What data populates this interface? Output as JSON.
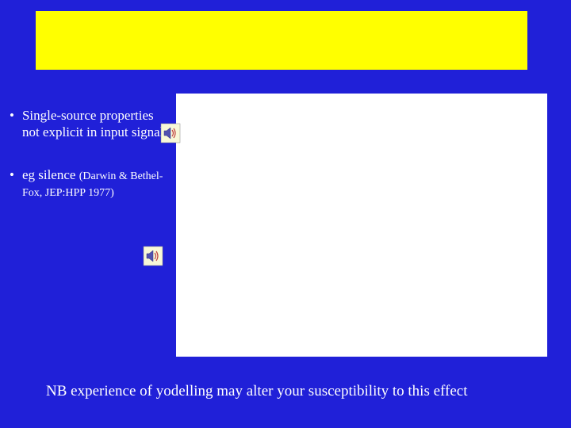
{
  "title": "",
  "bullets": [
    {
      "text": "Single-source properties not explicit in input signal",
      "citation": ""
    },
    {
      "text": "eg  silence  ",
      "citation": "(Darwin & Bethel-Fox, JEP:HPP 1977)"
    }
  ],
  "footnote": "NB experience of yodelling may alter your susceptibility to this effect",
  "icons": {
    "speaker": "sound-speaker-icon"
  }
}
